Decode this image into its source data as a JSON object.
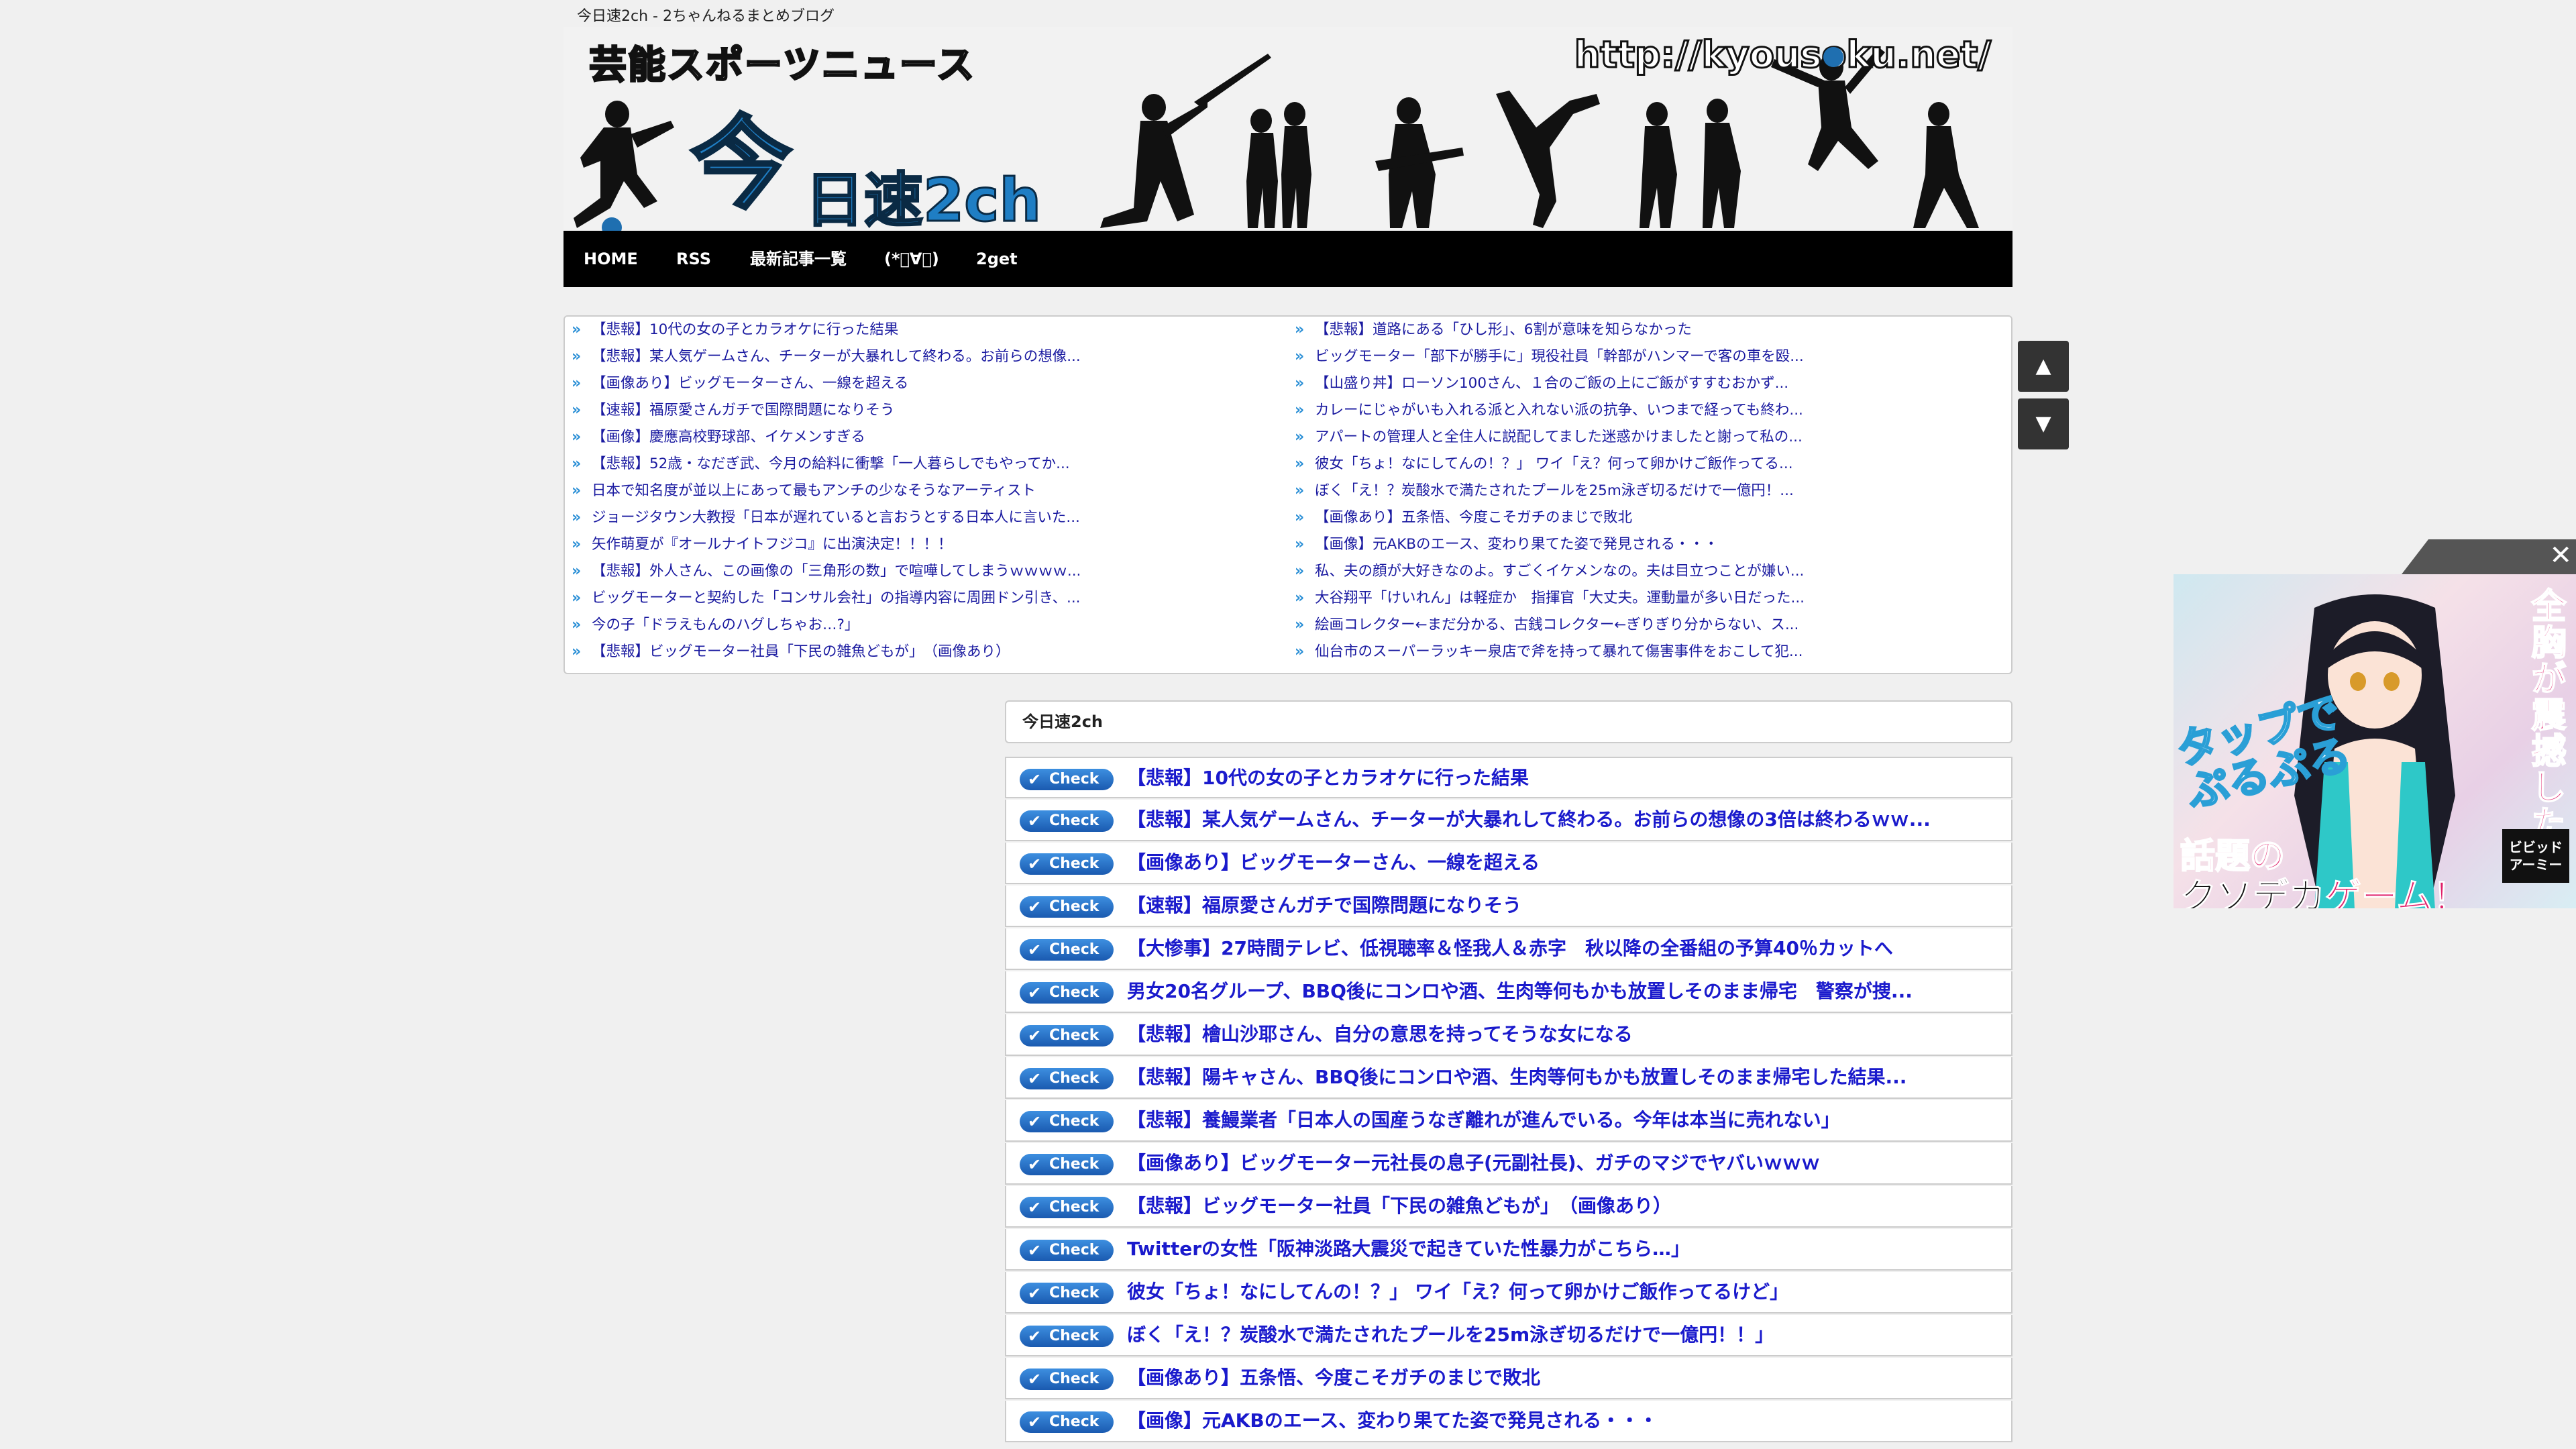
{
  "site": {
    "tagline": "今日速2ch - 2ちゃんねるまとめブログ",
    "banner_title": "芸能スポーツニュース",
    "banner_url": "http://kyousoku.net/",
    "logo_kanji": "今",
    "logo_sub": "日速2ch"
  },
  "nav": {
    "items": [
      "HOME",
      "RSS",
      "最新記事一覧",
      "(*ﾟ∀ﾟ)",
      "2get"
    ]
  },
  "antenna": {
    "left": [
      "【悲報】10代の女の子とカラオケに行った結果",
      "【悲報】某人気ゲームさん、チーターが大暴れして終わる。お前らの想像...",
      "【画像あり】ビッグモーターさん、一線を超える",
      "【速報】福原愛さんガチで国際問題になりそう",
      "【画像】慶應高校野球部、イケメンすぎる",
      "【悲報】52歳・なだぎ武、今月の給料に衝撃「一人暮らしでもやってか...",
      "日本で知名度が並以上にあって最もアンチの少なそうなアーティスト",
      "ジョージタウン大教授「日本が遅れていると言おうとする日本人に言いた...",
      "矢作萌夏が『オールナイトフジコ』に出演決定！！！！",
      "【悲報】外人さん、この画像の「三角形の数」で喧嘩してしまうｗｗｗｗ...",
      "ビッグモーターと契約した「コンサル会社」の指導内容に周囲ドン引き、...",
      "今の子「ドラえもんのハグしちゃお…?」",
      "【悲報】ビッグモーター社員「下民の雑魚どもが」　（画像あり）"
    ],
    "right": [
      "【悲報】道路にある「ひし形」、6割が意味を知らなかった",
      "ビッグモーター「部下が勝手に」現役社員「幹部がハンマーで客の車を殴...",
      "【山盛り丼】ローソン100さん、１合のご飯の上にご飯がすすむおかず...",
      "カレーにじゃがいも入れる派と入れない派の抗争、いつまで経っても終わ...",
      "アパートの管理人と全住人に説配してました迷惑かけましたと謝って私の...",
      "彼女「ちょ！なにしてんの！？」 ワイ「え？何って卵かけご飯作ってる...",
      "ぼく「え！？炭酸水で満たされたプールを25m泳ぎ切るだけで一億円！...",
      "【画像あり】五条悟、今度こそガチのまじで敗北",
      "【画像】元AKBのエース、変わり果てた姿で発見される・・・",
      "私、夫の顔が大好きなのよ。すごくイケメンなの。夫は目立つことが嫌い...",
      "大谷翔平「けいれん」は軽症か　指揮官「大丈夫。運動量が多い日だった...",
      "絵画コレクター←まだ分かる、古銭コレクター←ぎりぎり分からない、ス...",
      "仙台市のスーパーラッキー泉店で斧を持って暴れて傷害事件をおこして犯..."
    ]
  },
  "scroll": {
    "up": "▲",
    "down": "▼"
  },
  "section": {
    "title": "今日速2ch"
  },
  "articles": {
    "badge": "Check",
    "items": [
      "【悲報】10代の女の子とカラオケに行った結果",
      "【悲報】某人気ゲームさん、チーターが大暴れして終わる。お前らの想像の3倍は終わるｗｗ...",
      "【画像あり】ビッグモーターさん、一線を超える",
      "【速報】福原愛さんガチで国際問題になりそう",
      "【大惨事】27時間テレビ、低視聴率＆怪我人＆赤字　秋以降の全番組の予算40％カットへ",
      "男女20名グループ、BBQ後にコンロや酒、生肉等何もかも放置しそのまま帰宅　警察が捜...",
      "【悲報】檜山沙耶さん、自分の意思を持ってそうな女になる",
      "【悲報】陽キャさん、BBQ後にコンロや酒、生肉等何もかも放置しそのまま帰宅した結果...",
      "【悲報】養鰻業者「日本人の国産うなぎ離れが進んでいる。今年は本当に売れない」",
      "【画像あり】ビッグモーター元社長の息子(元副社長)、ガチのマジでヤバいｗｗｗ",
      "【悲報】ビッグモーター社員「下民の雑魚どもが」　（画像あり）",
      "Twitterの女性「阪神淡路大震災で起きていた性暴力がこちら…」",
      "彼女「ちょ！なにしてんの！？」 ワイ「え？何って卵かけご飯作ってるけど」",
      "ぼく「え！？炭酸水で満たされたプールを25m泳ぎ切るだけで一億円！！」",
      "【画像あり】五条悟、今度こそガチのまじで敗北",
      "【画像】元AKBのエース、変わり果てた姿で発見される・・・"
    ]
  },
  "ad": {
    "close": "✕",
    "tap": "タップで",
    "tap2": "ぷるぷる",
    "vertical": "全胸が震撼した",
    "wadai": "話題の",
    "kuso": "クソデカ",
    "game": "ゲーム！",
    "logo": "ビビッド アーミー"
  },
  "colors": {
    "nav_bg": "#000000",
    "link": "#1a1acc",
    "accent": "#1f7ec4"
  }
}
